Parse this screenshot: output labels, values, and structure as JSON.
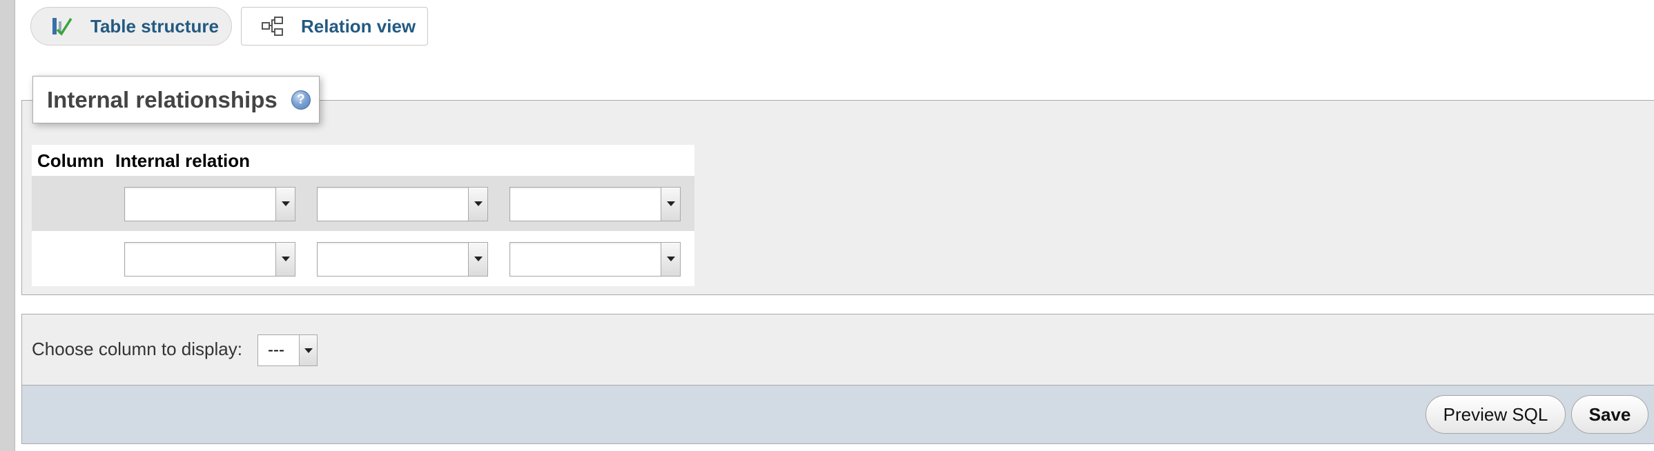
{
  "tabs": {
    "structure": {
      "label": "Table structure",
      "icon": "table-structure-icon"
    },
    "relation": {
      "label": "Relation view",
      "icon": "relation-view-icon"
    }
  },
  "relations": {
    "legend": "Internal relationships",
    "help_icon": "help-icon",
    "headers": {
      "column": "Column",
      "internal_relation": "Internal relation"
    }
  },
  "display": {
    "label": "Choose column to display:",
    "selected": "---"
  },
  "footer": {
    "preview_label": "Preview SQL",
    "save_label": "Save"
  },
  "colors": {
    "link": "#235a81",
    "fieldset_bg": "#eeeeee",
    "footer_bg": "#d2dae3",
    "odd_row": "#dfdfdf"
  }
}
